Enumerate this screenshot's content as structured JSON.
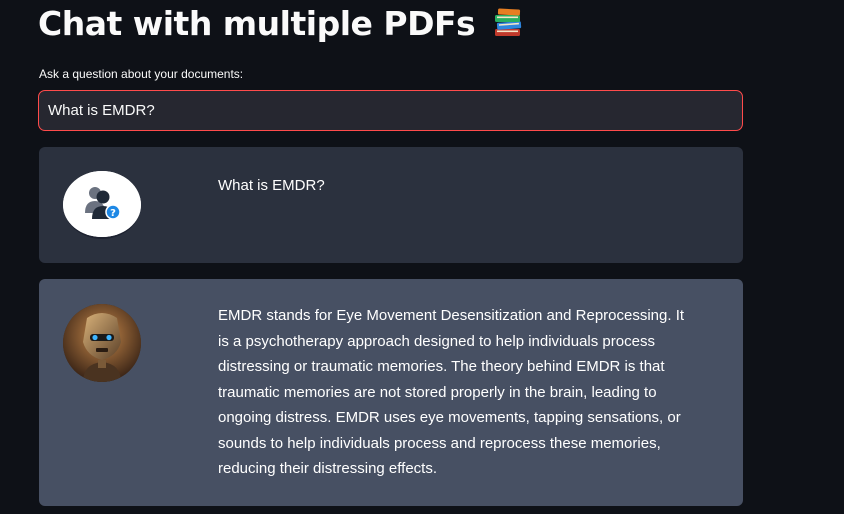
{
  "app": {
    "title": "Chat with multiple PDFs",
    "title_emoji_icon": "books-icon"
  },
  "question": {
    "label": "Ask a question about your documents:",
    "value": "What is EMDR?",
    "border_color": "#ff4b4b"
  },
  "messages": [
    {
      "role": "user",
      "avatar_icon": "user-question-avatar-icon",
      "text": "What is EMDR?",
      "background": "#2b313e"
    },
    {
      "role": "bot",
      "avatar_icon": "robot-avatar-icon",
      "text": "EMDR stands for Eye Movement Desensitization and Reprocessing. It is a psychotherapy approach designed to help individuals process distressing or traumatic memories. The theory behind EMDR is that traumatic memories are not stored properly in the brain, leading to ongoing distress. EMDR uses eye movements, tapping sensations, or sounds to help individuals process and reprocess these memories, reducing their distressing effects.",
      "background": "#475063"
    }
  ]
}
